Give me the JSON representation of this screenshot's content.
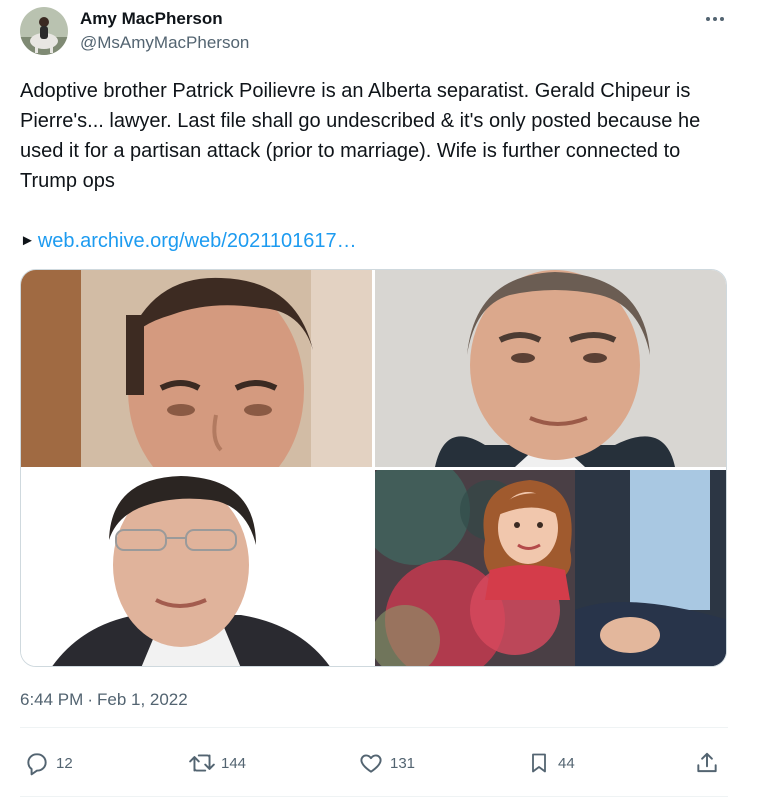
{
  "author": {
    "display_name": "Amy MacPherson",
    "handle": "@MsAmyMacPherson"
  },
  "tweet": {
    "text": "Adoptive brother Patrick Poilievre is an Alberta separatist. Gerald Chipeur is Pierre's... lawyer. Last file shall go undescribed & it's only posted because he used it for a partisan attack (prior to marriage). Wife is further connected to Trump ops",
    "link_prefix": "►",
    "link_text": "web.archive.org/web/2021101617…",
    "time": "6:44 PM",
    "separator": "·",
    "date": "Feb 1, 2022"
  },
  "media": [
    {
      "name": "photo-man-1"
    },
    {
      "name": "photo-man-2"
    },
    {
      "name": "photo-man-3"
    },
    {
      "name": "photo-girl"
    }
  ],
  "actions": {
    "reply": {
      "icon": "reply-icon",
      "count": "12"
    },
    "retweet": {
      "icon": "retweet-icon",
      "count": "144"
    },
    "like": {
      "icon": "heart-icon",
      "count": "131"
    },
    "bookmark": {
      "icon": "bookmark-icon",
      "count": "44"
    },
    "share": {
      "icon": "share-icon"
    }
  },
  "colors": {
    "link": "#1d9bf0",
    "text": "#0f1419",
    "secondary": "#536471",
    "border": "#cfd9de"
  }
}
